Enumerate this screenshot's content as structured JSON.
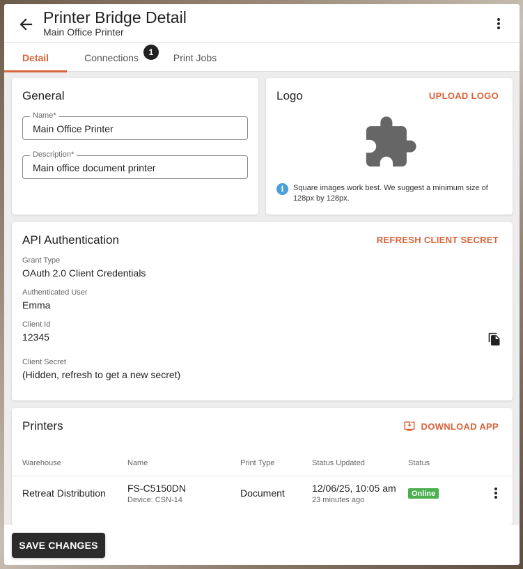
{
  "header": {
    "title": "Printer Bridge Detail",
    "subtitle": "Main Office Printer"
  },
  "tabs": [
    {
      "label": "Detail",
      "active": true
    },
    {
      "label": "Connections",
      "badge": "1"
    },
    {
      "label": "Print Jobs"
    }
  ],
  "general": {
    "title": "General",
    "name_label": "Name*",
    "name_value": "Main Office Printer",
    "description_label": "Description*",
    "description_value": "Main office document printer"
  },
  "logo": {
    "title": "Logo",
    "upload_label": "UPLOAD LOGO",
    "info_text": "Square images work best. We suggest a minimum size of 128px by 128px.",
    "info_icon_glyph": "i"
  },
  "api": {
    "title": "API Authentication",
    "refresh_label": "REFRESH CLIENT SECRET",
    "grant_type_label": "Grant Type",
    "grant_type_value": "OAuth 2.0 Client Credentials",
    "user_label": "Authenticated User",
    "user_value": "Emma",
    "client_id_label": "Client Id",
    "client_id_value": "12345",
    "secret_label": "Client Secret",
    "secret_value": "(Hidden, refresh to get a new secret)"
  },
  "printers": {
    "title": "Printers",
    "download_label": "DOWNLOAD APP",
    "columns": [
      "Warehouse",
      "Name",
      "Print Type",
      "Status Updated",
      "Status"
    ],
    "rows": [
      {
        "warehouse": "Retreat Distribution",
        "name": "FS-C5150DN",
        "device": "Device: CSN-14",
        "print_type": "Document",
        "status_updated": "12/06/25, 10:05 am",
        "status_updated_relative": "23 minutes ago",
        "status": "Online"
      }
    ]
  },
  "footer": {
    "save_label": "SAVE CHANGES"
  },
  "colors": {
    "accent": "#d8643a",
    "online": "#4caf50",
    "info": "#4a9fd8",
    "dark_button": "#2b2b2b"
  }
}
